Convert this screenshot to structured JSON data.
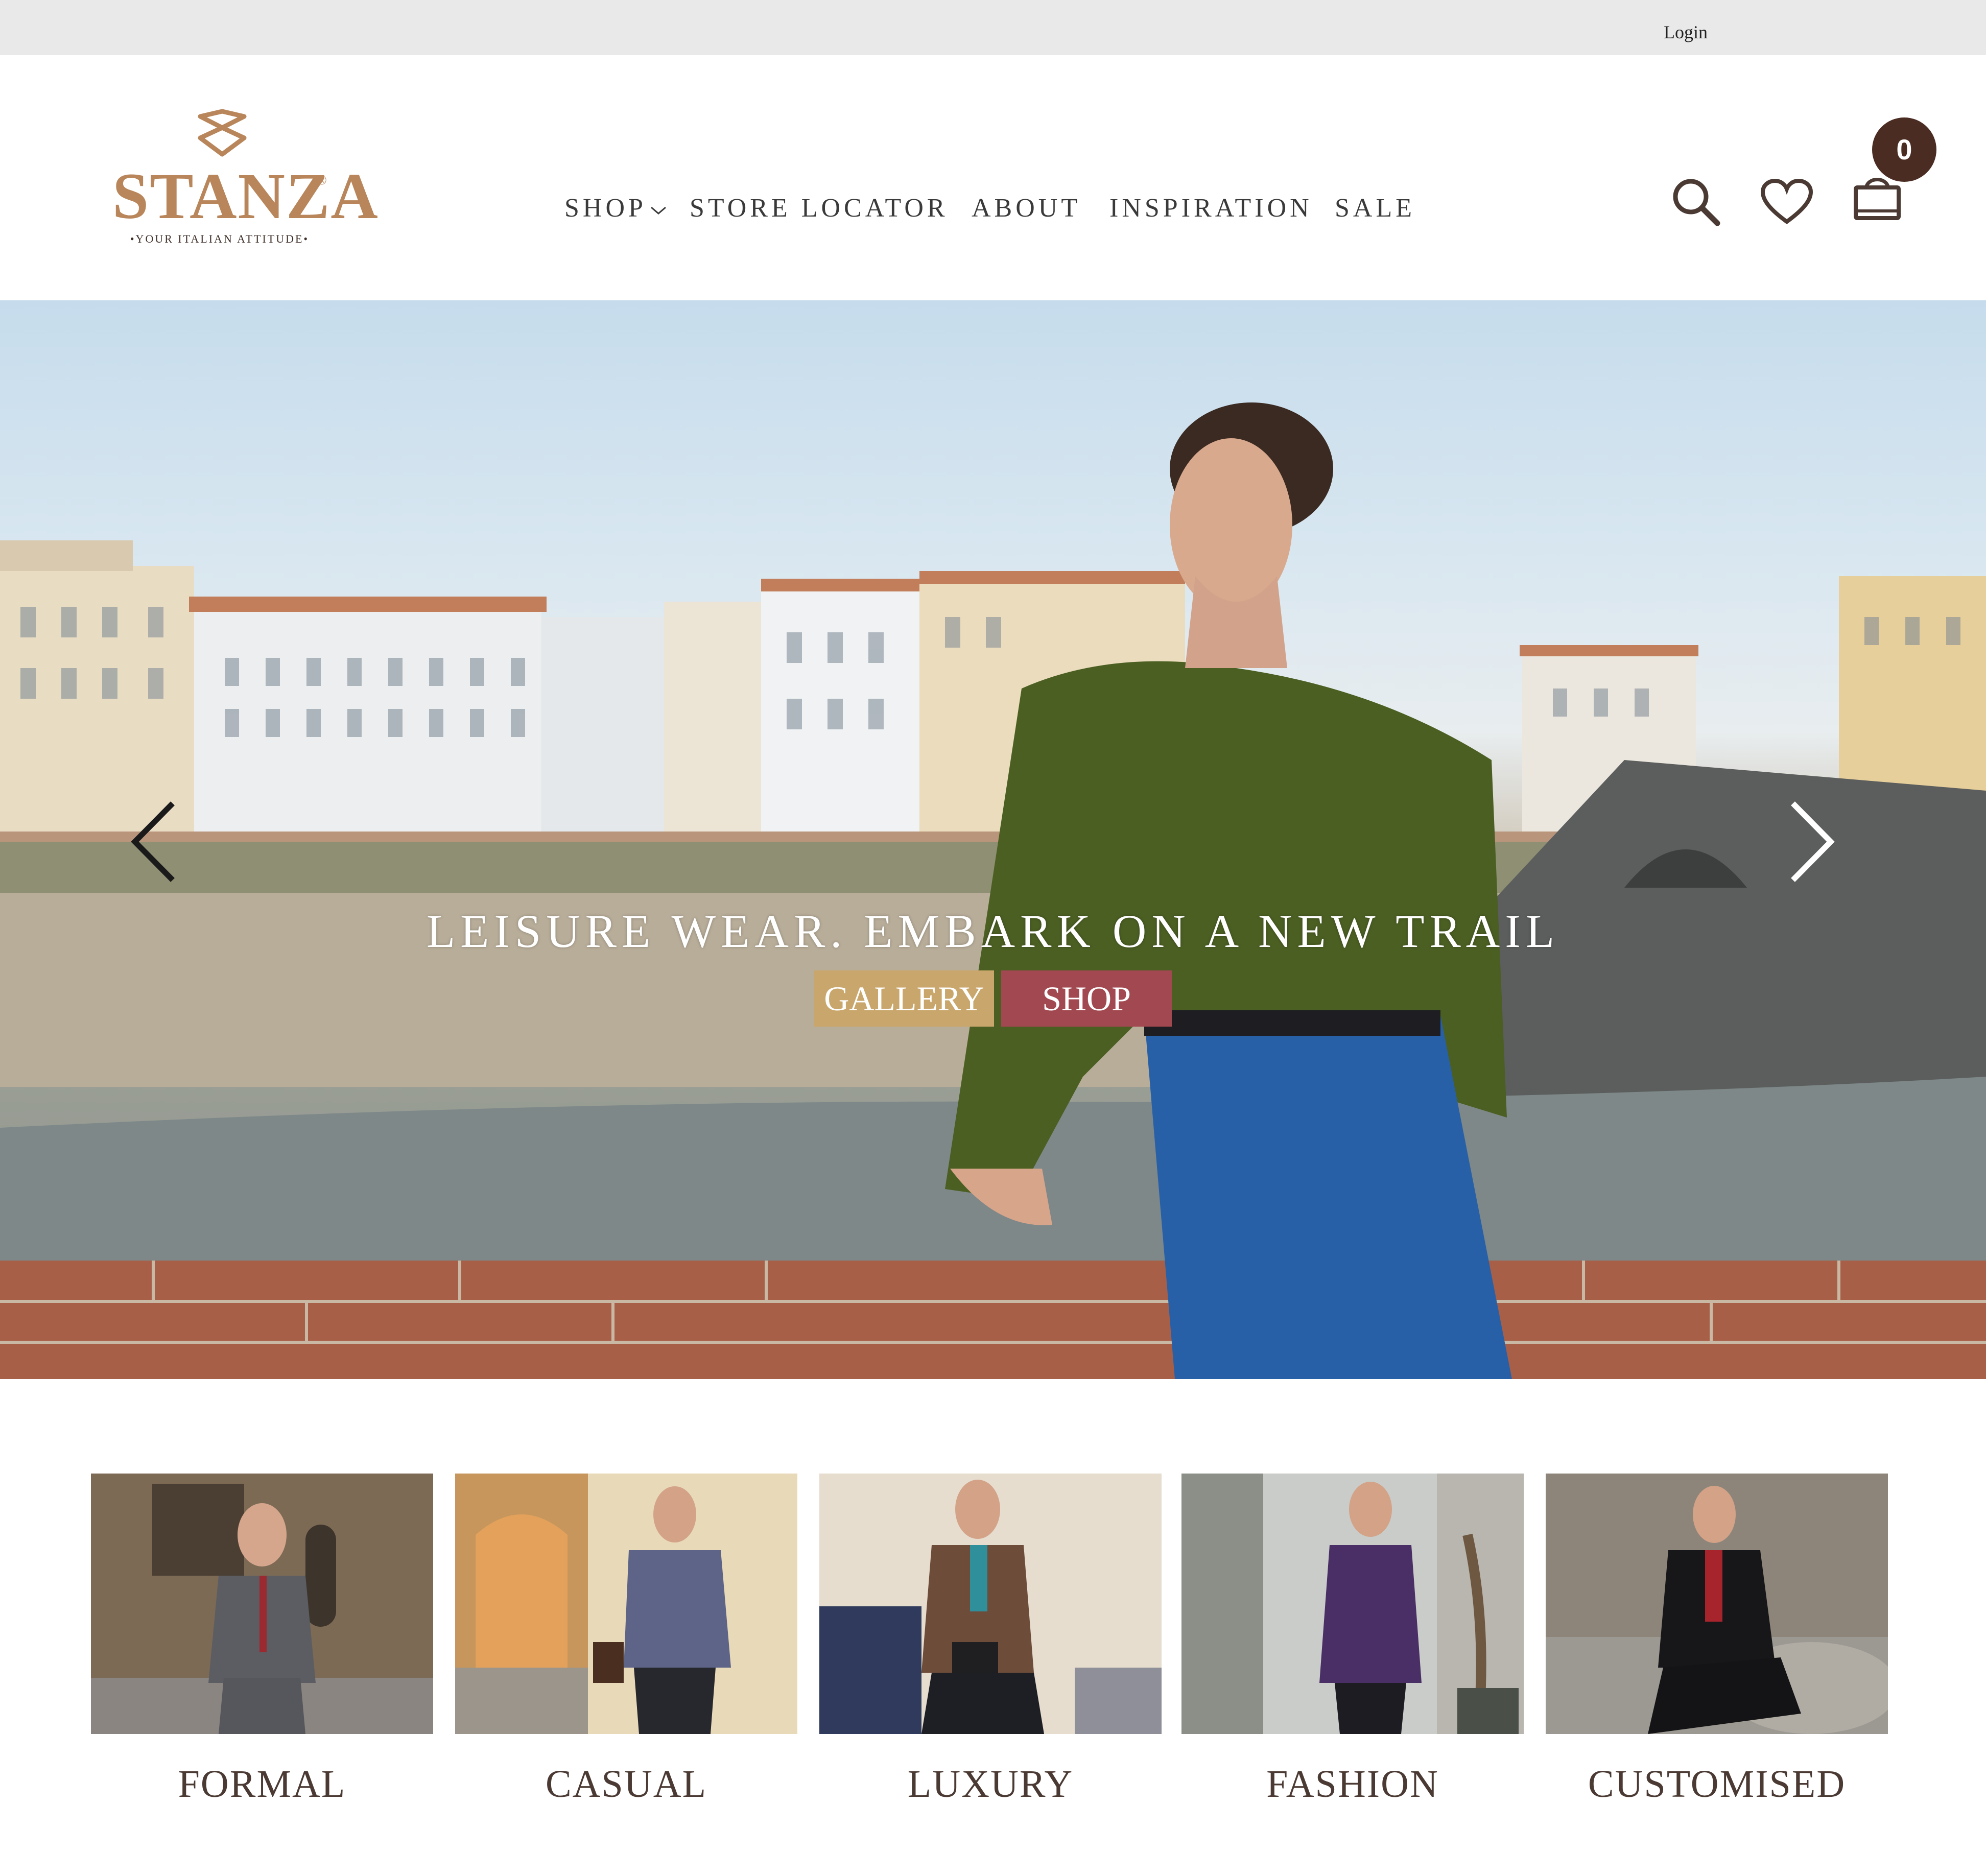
{
  "topbar": {
    "login_label": "Login"
  },
  "brand": {
    "name": "STANZA",
    "registered": "®",
    "tagline": "•YOUR ITALIAN ATTITUDE•",
    "color": "#b8865a"
  },
  "nav": {
    "items": [
      {
        "label": "SHOP",
        "has_dropdown": true
      },
      {
        "label": "STORE LOCATOR"
      },
      {
        "label": "ABOUT"
      },
      {
        "label": "INSPIRATION"
      },
      {
        "label": "SALE"
      }
    ]
  },
  "header_icons": {
    "search": "search-icon",
    "wishlist": "heart-icon",
    "cart": "shopping-bag-icon",
    "cart_count": "0"
  },
  "hero": {
    "caption": "LEISURE WEAR. EMBARK ON A NEW TRAIL",
    "gallery_label": "GALLERY",
    "shop_label": "SHOP",
    "gallery_color": "#c9a66b",
    "shop_color": "#a24850"
  },
  "categories": [
    {
      "label": "FORMAL"
    },
    {
      "label": "CASUAL"
    },
    {
      "label": "LUXURY"
    },
    {
      "label": "FASHION"
    },
    {
      "label": "CUSTOMISED"
    }
  ]
}
